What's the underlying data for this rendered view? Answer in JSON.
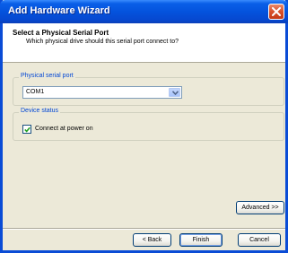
{
  "window": {
    "title": "Add Hardware Wizard",
    "close_icon": "close-icon"
  },
  "header": {
    "title": "Select a Physical Serial Port",
    "subtitle": "Which physical drive should this serial port connect to?"
  },
  "serial_port_group": {
    "legend": "Physical serial port",
    "selected": "COM1",
    "dropdown_icon": "chevron-down-icon"
  },
  "device_status_group": {
    "legend": "Device status",
    "checkbox_label": "Connect at power on",
    "checked": true
  },
  "buttons": {
    "advanced": "Advanced >>",
    "back": "< Back",
    "finish": "Finish",
    "cancel": "Cancel"
  },
  "colors": {
    "title_bar": "#0453dd",
    "dialog_bg": "#ece9d8",
    "group_legend": "#0046d5",
    "close_button": "#d8502b"
  }
}
